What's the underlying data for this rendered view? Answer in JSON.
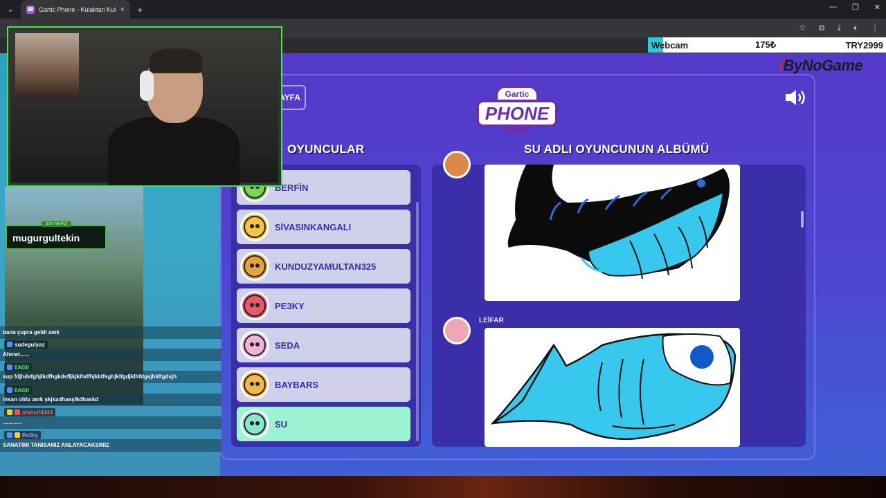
{
  "browser": {
    "tab_title": "Gartic Phone - Kulaktan Kulağa",
    "tab_close": "×",
    "new_tab": "+",
    "tab_list": "⌄",
    "win_min": "—",
    "win_max": "❐",
    "win_close": "✕",
    "toolbar_icons": [
      "☆",
      "⧉",
      "⤓",
      "◐",
      "⋮"
    ]
  },
  "ticker": {
    "name": "Webcam",
    "price": "175₺",
    "code": "TRY2999"
  },
  "brand": {
    "mark": "/",
    "name": "ByNoGame"
  },
  "game": {
    "back_label": "AYFA",
    "logo_top": "Gartic",
    "logo_main": "PHONE",
    "players_title": "OYUNCULAR",
    "album_title": "SU ADLI OYUNCUNUN ALBÜMÜ",
    "players": [
      {
        "name": "BERFİN",
        "color": "#7bd35a",
        "active": false
      },
      {
        "name": "SİVASINKANGALI",
        "color": "#f4c542",
        "active": false
      },
      {
        "name": "KUNDUZYAMULTAN325",
        "color": "#e8a23c",
        "active": false
      },
      {
        "name": "PE3KY",
        "color": "#e85a6b",
        "active": false
      },
      {
        "name": "SEDA",
        "color": "#f0b3d8",
        "active": false
      },
      {
        "name": "BAYBARS",
        "color": "#f2b94a",
        "active": false
      },
      {
        "name": "SU",
        "color": "#86e8c8",
        "active": true
      }
    ],
    "album_entries": [
      {
        "author": "",
        "drawing": "black-whale"
      },
      {
        "author": "LEİFAR",
        "drawing": "blue-fish"
      }
    ]
  },
  "overlay": {
    "name_tag_sub": "SON TAKİPÇİ",
    "name_tag": "mugurgultekin",
    "chat": [
      {
        "type": "msg",
        "text": "bana çupra geldi amk"
      },
      {
        "type": "user",
        "text": "sudegulyaz",
        "color": "#ffffff"
      },
      {
        "type": "msg",
        "text": "Ahmet......"
      },
      {
        "type": "user",
        "text": "llAGll",
        "color": "#5ee06b"
      },
      {
        "type": "msg",
        "text": "sup fdjhdsfghjlkdfhgkdsfljkjklhdfhjkldfsghjklfgdjklhfdgsjhklfgdsjh"
      },
      {
        "type": "user",
        "text": "llAGll",
        "color": "#5ee06b"
      },
      {
        "type": "msg",
        "text": "insan oldu amk şkjsadhasşlkdhaskd"
      },
      {
        "type": "user",
        "text": "ahmetf4444",
        "color": "#ff5a5a"
      },
      {
        "type": "msg",
        "text": "............"
      },
      {
        "type": "user",
        "text": "Pe3ky",
        "color": "#c58bff"
      },
      {
        "type": "msg",
        "text": "SANATIMI TANISANIZ ANLAYACAKSINIZ"
      }
    ]
  }
}
